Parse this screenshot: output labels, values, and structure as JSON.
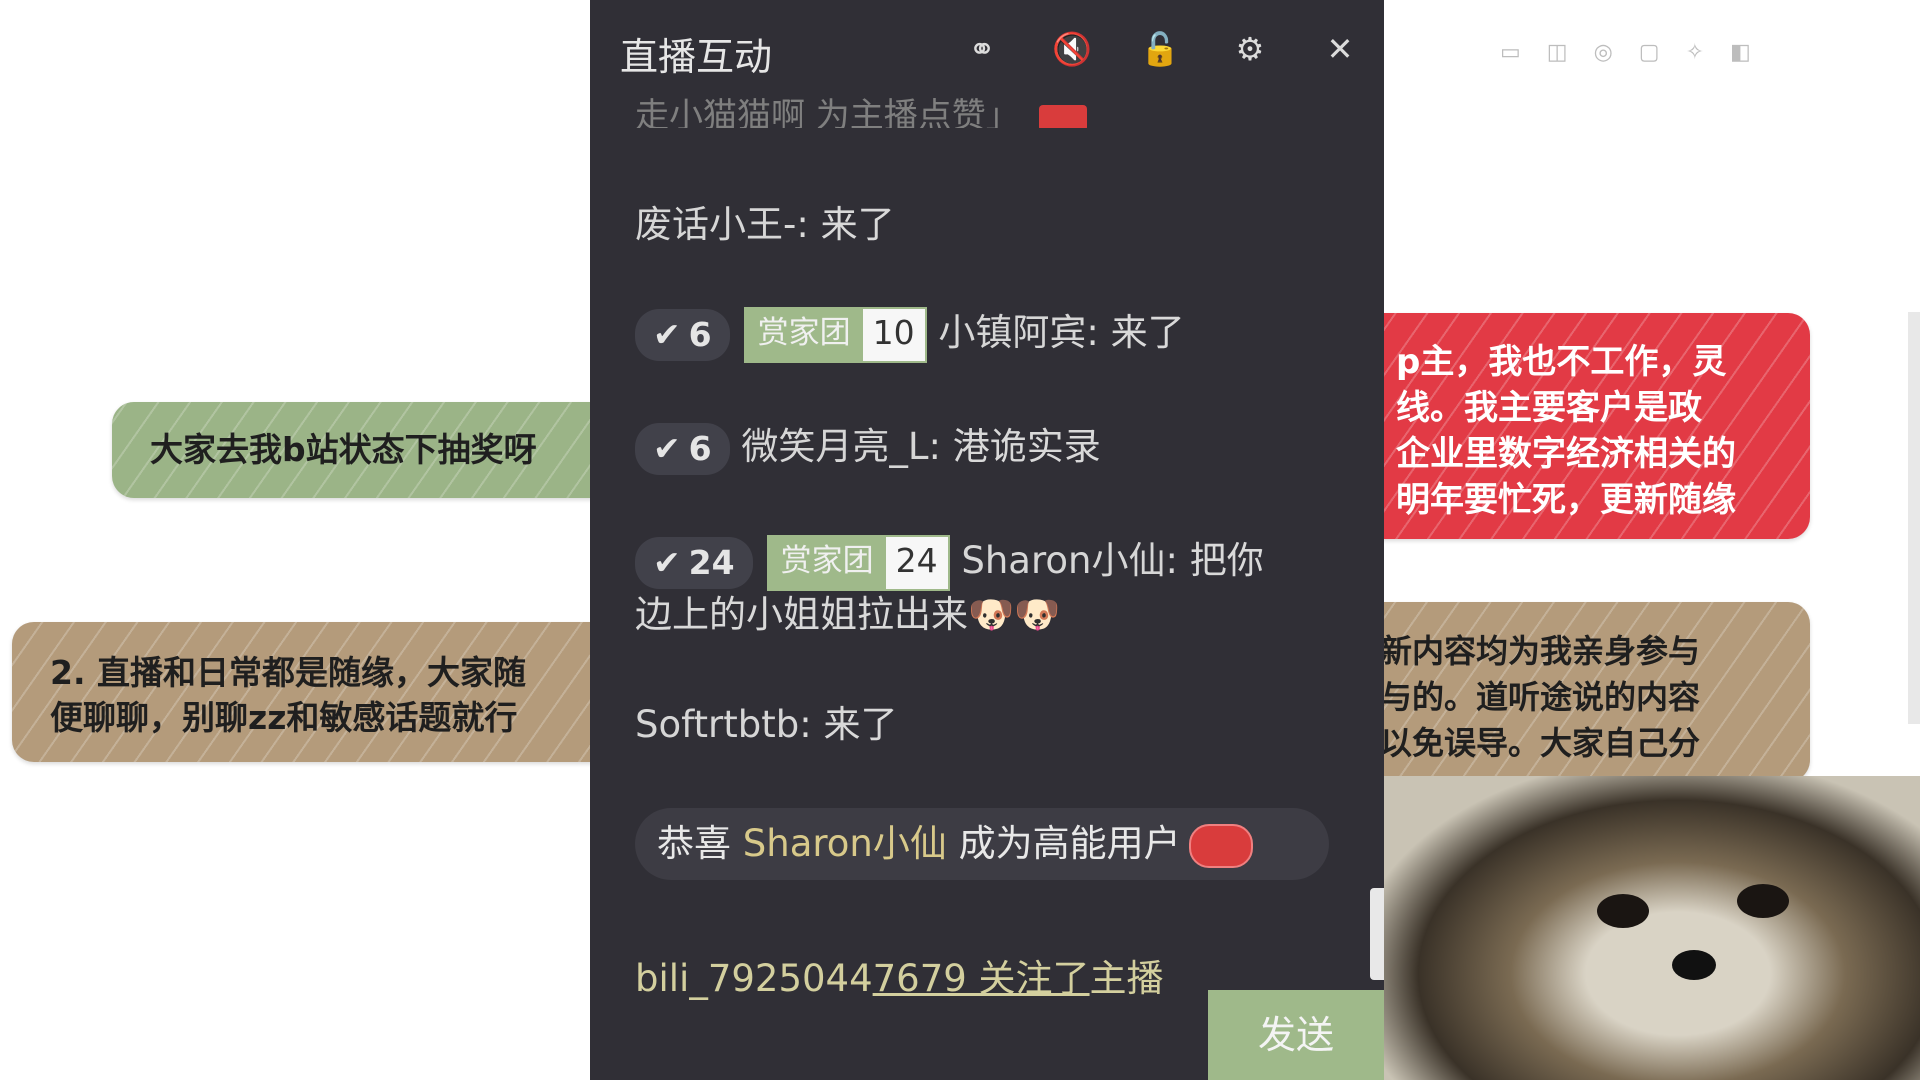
{
  "notes": {
    "green": "大家去我b站状态下抽奖呀",
    "tan_line1": "2. 直播和日常都是随缘，大家随",
    "tan_line2": "便聊聊，别聊zz和敏感话题就行",
    "red_lines": [
      "p主，我也不工作，灵",
      "线。我主要客户是政",
      "企业里数字经济相关的",
      "明年要忙死，更新随缘"
    ],
    "tan_right_lines": [
      "新内容均为我亲身参与",
      "与的。道听途说的内容",
      "以免误导。大家自己分"
    ]
  },
  "panel": {
    "title": "直播互动",
    "icons": [
      "link-icon",
      "mute-icon",
      "lock-icon",
      "gear-icon",
      "close-icon"
    ],
    "icon_glyphs": [
      "⚭",
      "🔇",
      "🔓",
      "⚙",
      "✕"
    ]
  },
  "messages": {
    "faded_top": "走小猫猫啊 为主播点赞」",
    "m1": {
      "user": "废话小王-",
      "text": ": 来了"
    },
    "m2": {
      "level": "6",
      "fan_name": "赏家团",
      "fan_level": "10",
      "user": "小镇阿宾",
      "text": ": 来了"
    },
    "m3": {
      "level": "6",
      "user": "微笑月亮_L",
      "text": ": 港诡实录"
    },
    "m4": {
      "level": "24",
      "fan_name": "赏家团",
      "fan_level": "24",
      "user": "Sharon小仙",
      "text": ": 把你",
      "text2": "边上的小姐姐拉出来🐶🐶"
    },
    "m5": {
      "user": "Softrtbtb",
      "text": ": 来了"
    },
    "congrats": {
      "prefix": "恭喜 ",
      "user": "Sharon小仙",
      "suffix": " 成为高能用户"
    },
    "follow": {
      "prefix": "bili_7925044",
      "underlined": "7679 关注了",
      "suffix": "主播"
    }
  },
  "send_button": "发送"
}
